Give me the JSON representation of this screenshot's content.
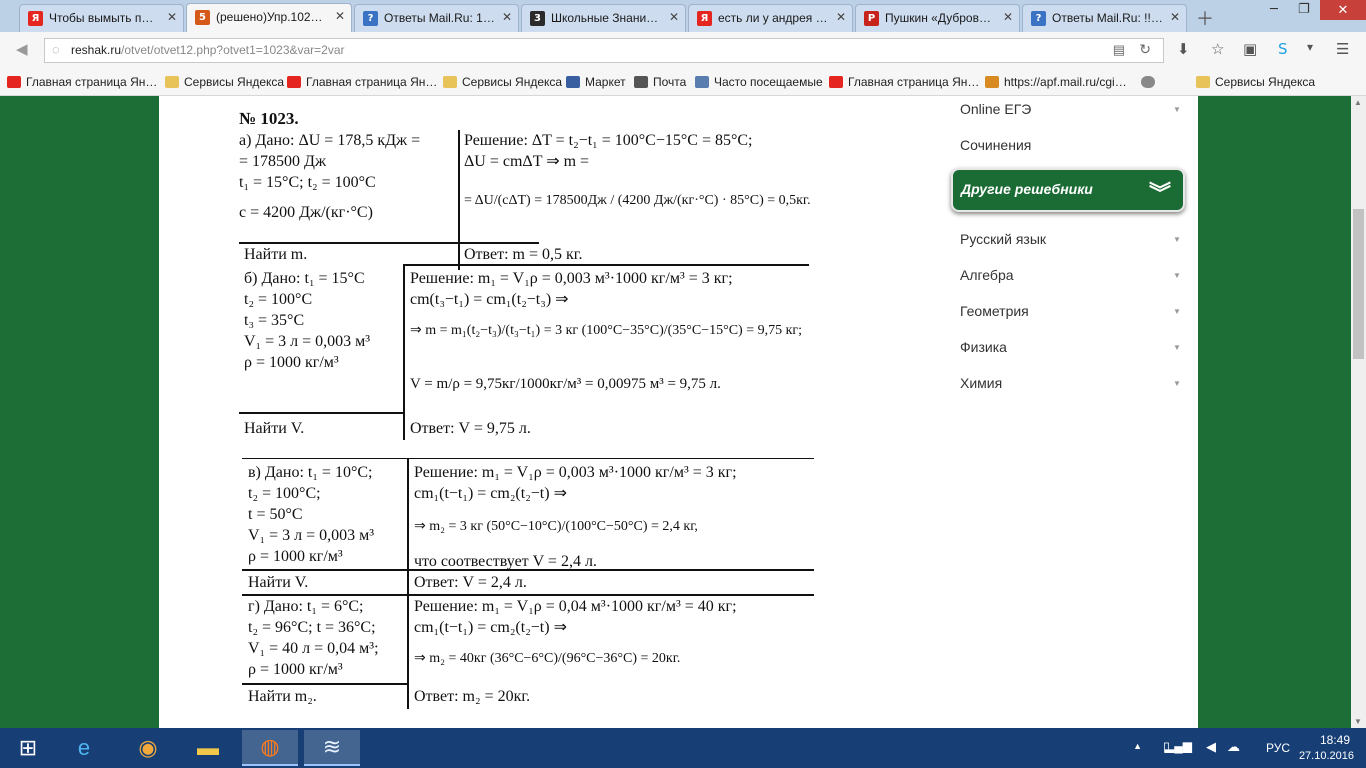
{
  "tabs": [
    {
      "icon": "Я",
      "color": "#e52620",
      "title": "Чтобы вымыть п…"
    },
    {
      "icon": "5",
      "color": "#d55a1a",
      "title": "(решено)Упр.102…"
    },
    {
      "icon": "?",
      "color": "#3a72c4",
      "title": "Ответы Mail.Ru: 1…"
    },
    {
      "icon": "3",
      "color": "#2a2a2a",
      "title": "Школьные Знани…"
    },
    {
      "icon": "Я",
      "color": "#e52620",
      "title": "есть ли у андрея …"
    },
    {
      "icon": "P",
      "color": "#c7231b",
      "title": "Пушкин «Дубров…"
    },
    {
      "icon": "?",
      "color": "#3a72c4",
      "title": "Ответы Mail.Ru: !!…"
    }
  ],
  "address": {
    "host": "reshak.ru",
    "path": "/otvet/otvet12.php?otvet1=1023&var=2var"
  },
  "bookmarks": [
    {
      "label": "Главная страница Ян…",
      "color": "#e52620"
    },
    {
      "label": "Сервисы Яндекса",
      "color": "#e8c35a"
    },
    {
      "label": "Главная страница Ян…",
      "color": "#e52620"
    },
    {
      "label": "Сервисы Яндекса",
      "color": "#e8c35a"
    },
    {
      "label": "Маркет",
      "color": "#3a5fa0"
    },
    {
      "label": "Почта",
      "color": "#555555"
    },
    {
      "label": "Часто посещаемые",
      "color": "#5a7db0"
    },
    {
      "label": "Главная страница Ян…",
      "color": "#e52620"
    },
    {
      "label": "https://apf.mail.ru/cgi…",
      "color": "#d98a20"
    },
    {
      "label": "",
      "color": "#888888"
    },
    {
      "label": "Сервисы Яндекса",
      "color": "#e8c35a"
    }
  ],
  "solution": {
    "number": "№ 1023.",
    "a": [
      "а) Дано: ΔU = 178,5 кДж =",
      "= 178500 Дж",
      "t₁ = 15°C; t₂ = 100°C",
      "c = 4200 Дж/(кг·°C)",
      "Найти m.",
      "Решение: ΔT = t₂−t₁ = 100°C−15°C = 85°C;",
      "ΔU = cmΔT ⇒ m =",
      "= ΔU/(cΔT) = 178500Дж / (4200 Дж/(кг·°C) · 85°C) = 0,5кг.",
      "Ответ: m = 0,5 кг."
    ],
    "b": [
      "б) Дано: t₁ = 15°C",
      "t₂ = 100°C",
      "t₃ = 35°C",
      "V₁ = 3 л = 0,003 м³",
      "ρ = 1000 кг/м³",
      "Найти V.",
      "Решение: m₁ = V₁ρ = 0,003 м³·1000 кг/м³ = 3 кг;",
      "cm(t₃−t₁) = cm₁(t₂−t₃) ⇒",
      "⇒ m = m₁(t₂−t₃)/(t₃−t₁) = 3 кг (100°C−35°C)/(35°C−15°C) = 9,75 кг;",
      "V = m/ρ = 9,75кг/1000кг/м³ = 0,00975 м³ = 9,75 л.",
      "Ответ: V = 9,75 л."
    ],
    "c": [
      "в) Дано: t₁ = 10°C;",
      "t₂ = 100°C;",
      "t = 50°C",
      "V₁ = 3 л = 0,003 м³",
      "ρ = 1000 кг/м³",
      "Найти V.",
      "Решение: m₁ = V₁ρ = 0,003 м³·1000 кг/м³ = 3 кг;",
      "cm₁(t−t₁) = cm₂(t₂−t) ⇒",
      "⇒ m₂ = 3 кг (50°C−10°C)/(100°C−50°C) = 2,4 кг,",
      "что соотвествует V = 2,4 л.",
      "Ответ: V = 2,4 л."
    ],
    "d": [
      "г) Дано: t₁ = 6°C;",
      "t₂ = 96°C; t = 36°C;",
      "V₁ = 40 л = 0,04 м³;",
      "ρ = 1000 кг/м³",
      "Найти m₂.",
      "Решение: m₁ = V₁ρ = 0,04 м³·1000 кг/м³ = 40 кг;",
      "cm₁(t−t₁) = cm₂(t₂−t) ⇒",
      "⇒ m₂ = 40кг (36°C−6°C)/(96°C−36°C) = 20кг.",
      "Ответ: m₂ = 20кг."
    ]
  },
  "sidebar": {
    "items_top": [
      "Online ЕГЭ",
      "Сочинения"
    ],
    "featured": "Другие решебники",
    "items": [
      "Русский язык",
      "Алгебра",
      "Геометрия",
      "Физика",
      "Химия"
    ]
  },
  "tray": {
    "lang": "РУС",
    "time": "18:49",
    "date": "27.10.2016"
  }
}
